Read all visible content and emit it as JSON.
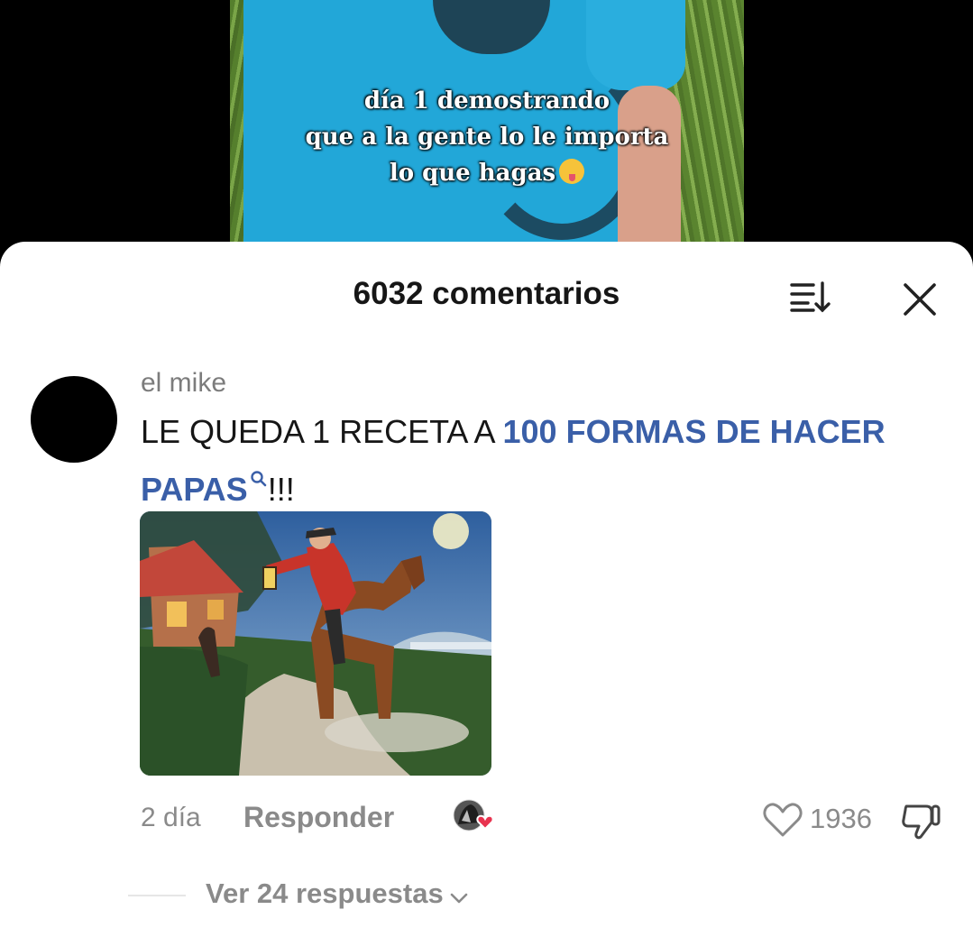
{
  "video": {
    "caption_lines": [
      "día 1 demostrando",
      "que a la gente lo le importa",
      "lo que hagas"
    ],
    "caption_emoji": "squinting-face-with-tongue-icon"
  },
  "sheet": {
    "title": "6032 comentarios",
    "sort_icon": "sort-icon",
    "close_icon": "close-icon"
  },
  "comment": {
    "username": "el mike",
    "text_prefix": "LE QUEDA 1 RECETA A ",
    "link_text": "100 FORMAS DE HACER PAPAS",
    "text_suffix": "!!!",
    "image": "painting-rider-on-horse-with-lantern",
    "date": "2 día",
    "reply_label": "Responder",
    "like_count": "1936",
    "view_replies_label": "Ver 24 respuestas"
  },
  "colors": {
    "link": "#3a5fa8",
    "muted": "#8a8a8a",
    "heart_badge": "#e8334f"
  }
}
